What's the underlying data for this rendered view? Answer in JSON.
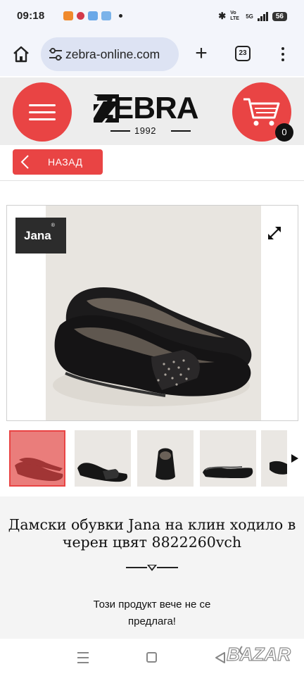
{
  "status_bar": {
    "time": "09:18",
    "network_label": "5G",
    "volte_label": "Vo LTE",
    "battery": "56"
  },
  "browser": {
    "url": "zebra-online.com",
    "tab_count": "23",
    "icons": [
      "home-icon",
      "tune-icon",
      "plus-icon",
      "tabs-icon",
      "more-vert-icon"
    ]
  },
  "site_header": {
    "logo_text": "ZEBRA",
    "logo_year": "1992",
    "cart_count": "0",
    "accent_color": "#e94444"
  },
  "back_button": {
    "label": "НАЗАД"
  },
  "product": {
    "brand_badge": "Jana",
    "brand_mark": "®",
    "title": "Дамски обувки Jana на клин ходило в черен цвят 8822260vch",
    "not_offered_line1": "Този продукт вече не се",
    "not_offered_line2": "предлага!",
    "thumbnail_count": 5,
    "active_thumbnail": 1
  },
  "watermark": {
    "text": "BAZAR"
  }
}
